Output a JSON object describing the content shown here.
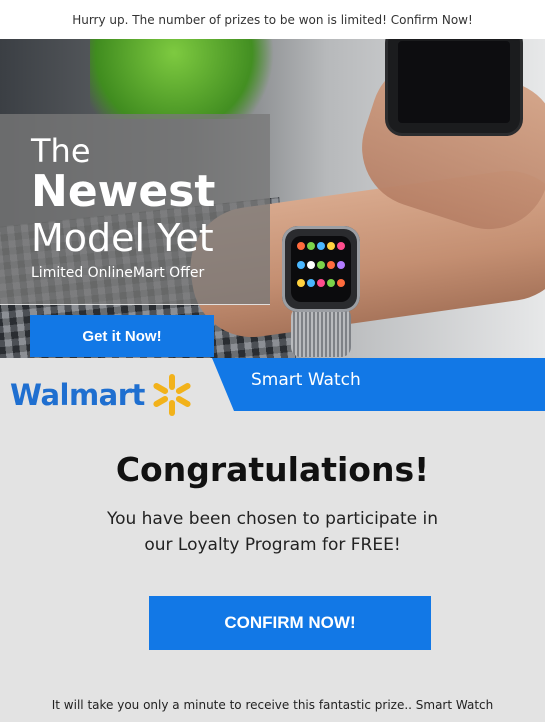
{
  "topbar": {
    "text": "Hurry up. The number of prizes to be won is limited! Confirm Now!"
  },
  "hero": {
    "line1": "The",
    "line2": "Newest",
    "line3": "Model Yet",
    "offer": "Limited OnlineMart Offer",
    "cta_label": "Get it Now!",
    "image_icon": "smartwatch-photo"
  },
  "brand": {
    "logo_text": "Walmart",
    "logo_icon": "spark-icon",
    "ribbon_text": "Smart Watch"
  },
  "main": {
    "headline": "Congratulations!",
    "message_line1": "You have been chosen to participate in",
    "message_line2": "our Loyalty Program for FREE!",
    "confirm_label": "CONFIRM NOW!",
    "footer_note": "It will take you only a minute to receive this fantastic prize.. Smart Watch"
  },
  "colors": {
    "accent": "#1278e6",
    "brand_blue": "#1f6fd0",
    "spark_yellow": "#f2b21a",
    "panel_bg": "#e3e3e3"
  }
}
